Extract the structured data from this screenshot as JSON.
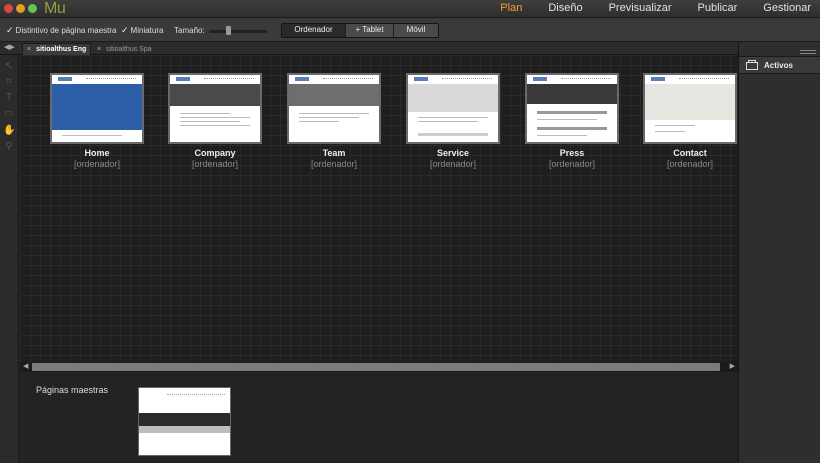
{
  "app": {
    "logo": "Mu",
    "nav": [
      "Plan",
      "Diseño",
      "Previsualizar",
      "Publicar",
      "Gestionar"
    ],
    "active_nav": "Plan"
  },
  "options": {
    "master_badge_label": "Distintivo de página maestra",
    "master_badge_checked": true,
    "thumbnail_label": "Miniatura",
    "thumbnail_checked": true,
    "size_label": "Tamaño:",
    "size_value": 0.3,
    "layouts": [
      "Ordenador",
      "+ Tablet",
      "Móvil"
    ],
    "active_layout": "Ordenador"
  },
  "tabs": [
    {
      "label": "sitioalthus Eng",
      "active": true
    },
    {
      "label": "sitioalthus Spa",
      "active": false
    }
  ],
  "tools": [
    "selection-tool-icon",
    "crop-tool-icon",
    "text-tool-icon",
    "rectangle-tool-icon",
    "hand-tool-icon",
    "zoom-tool-icon"
  ],
  "pages": [
    {
      "name": "Home",
      "breakpoint": "[ordenador]",
      "hero": "#2d5fa8"
    },
    {
      "name": "Company",
      "breakpoint": "[ordenador]",
      "hero": "#4a4a4a"
    },
    {
      "name": "Team",
      "breakpoint": "[ordenador]",
      "hero": "#6e6e6e"
    },
    {
      "name": "Service",
      "breakpoint": "[ordenador]",
      "hero": "#d9d9d9"
    },
    {
      "name": "Press",
      "breakpoint": "[ordenador]",
      "hero": "#3a3a3a"
    },
    {
      "name": "Contact",
      "breakpoint": "[ordenador]",
      "hero": "#e6e6e0"
    }
  ],
  "masters": {
    "title": "Páginas maestras"
  },
  "panel": {
    "title": "Activos",
    "icon": "assets-icon"
  },
  "colors": {
    "accent": "#f39c33",
    "logo": "#8fa33a"
  }
}
